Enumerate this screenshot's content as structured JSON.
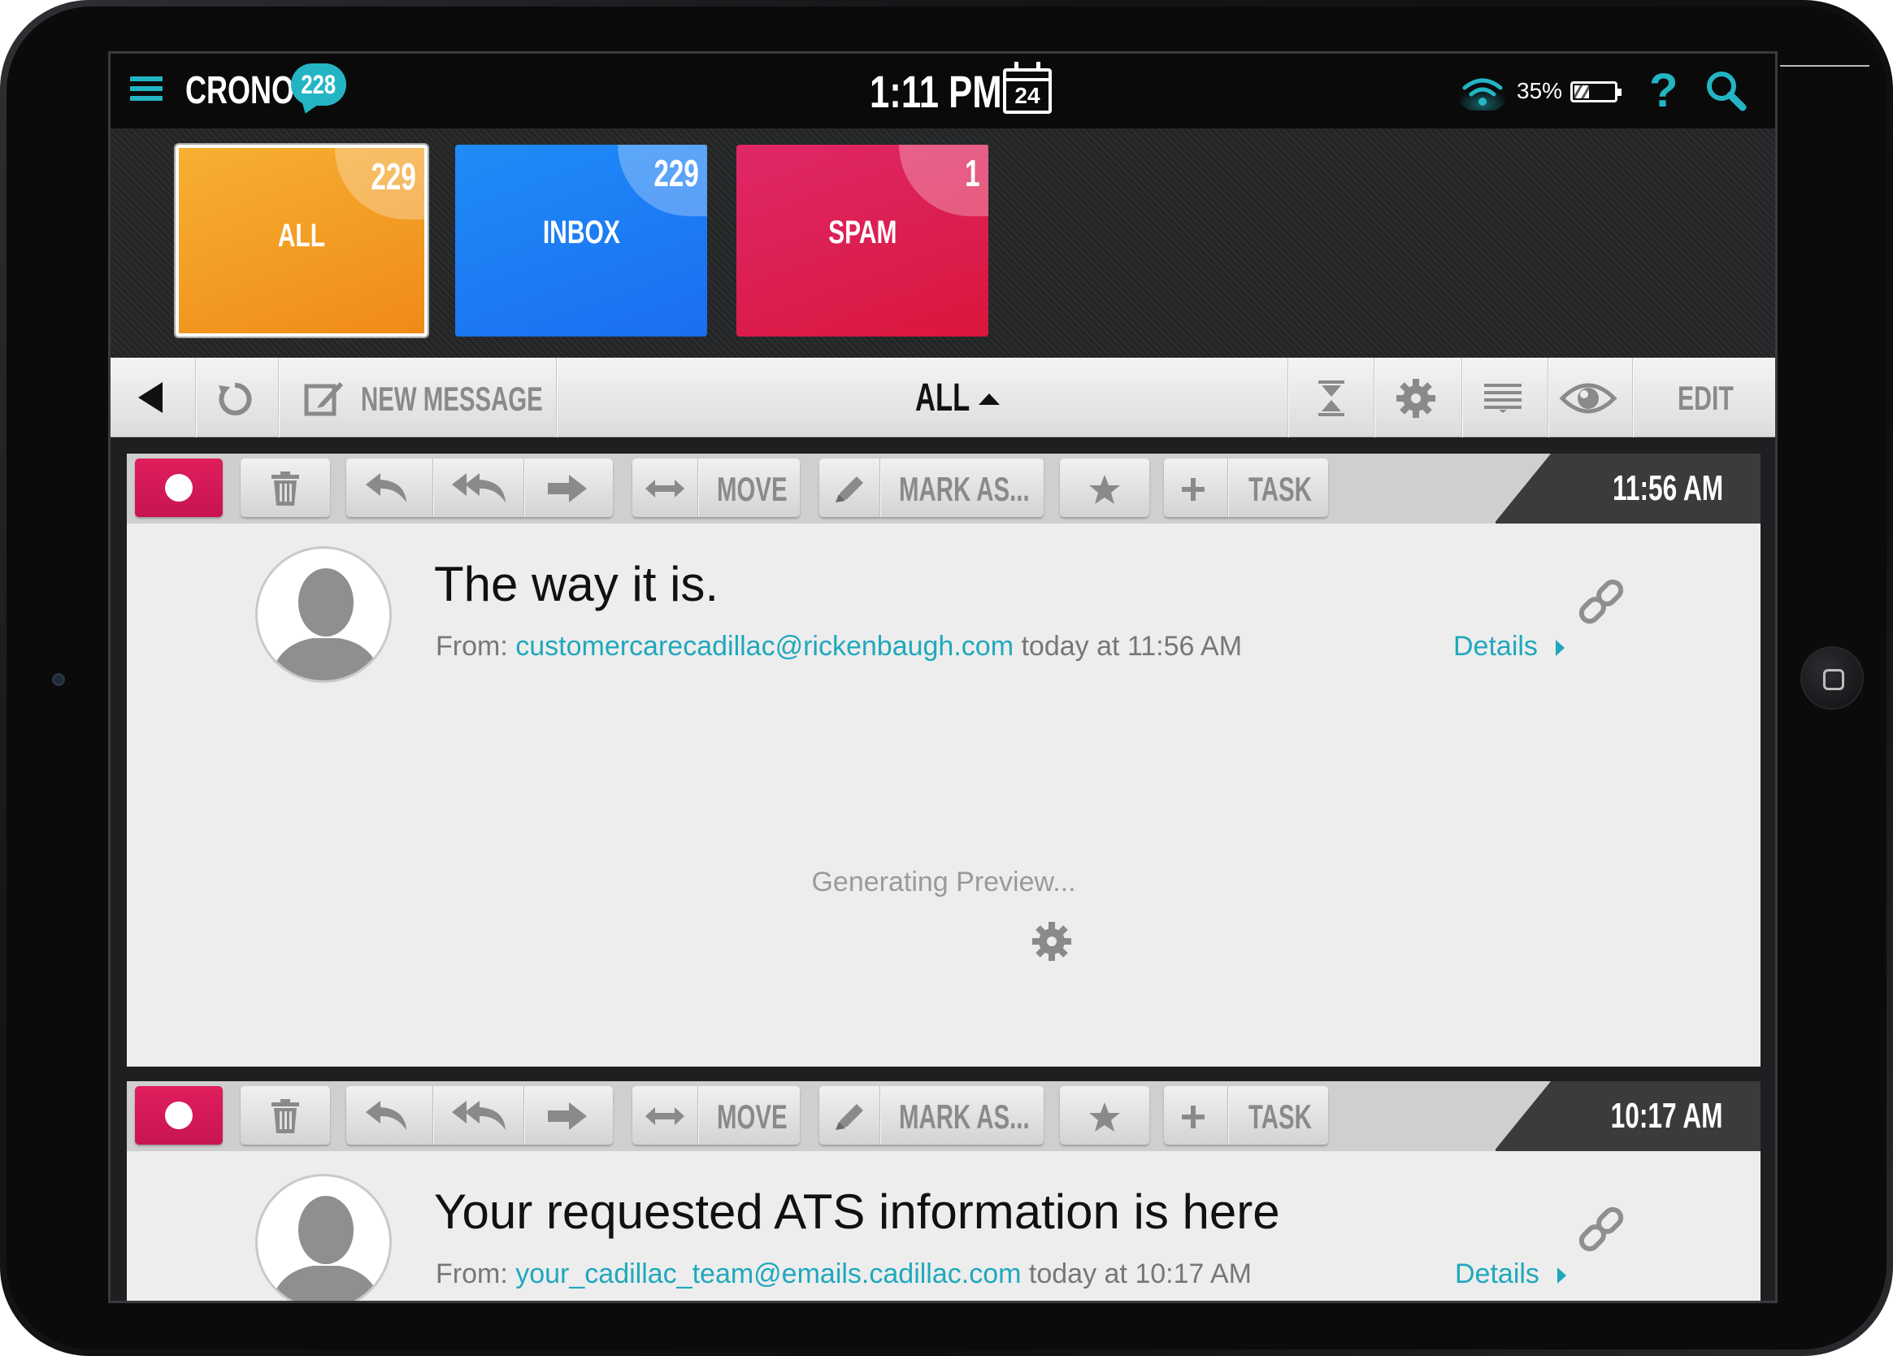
{
  "header": {
    "app_name": "CRONO",
    "unread_badge": "228",
    "clock": "1:11 PM",
    "calendar_day": "24",
    "battery_pct": "35%",
    "help_glyph": "?"
  },
  "tiles": [
    {
      "label": "ALL",
      "count": "229",
      "color": "#f29a1f"
    },
    {
      "label": "INBOX",
      "count": "229",
      "color": "#1d7ef4"
    },
    {
      "label": "SPAM",
      "count": "1",
      "color": "#dc1f4f"
    }
  ],
  "toolbar": {
    "new_message": "NEW MESSAGE",
    "folder": "ALL",
    "edit": "EDIT"
  },
  "actions": {
    "move": "MOVE",
    "mark_as": "MARK AS...",
    "task": "TASK"
  },
  "messages": [
    {
      "time": "11:56 AM",
      "subject": "The way it is.",
      "from_label": "From:",
      "from_addr": "customercarecadillac@rickenbaugh.com",
      "when": "today at 11:56 AM",
      "details": "Details",
      "preview_status": "Generating Preview..."
    },
    {
      "time": "10:17 AM",
      "subject": "Your requested ATS information is here",
      "from_label": "From:",
      "from_addr": "your_cadillac_team@emails.cadillac.com",
      "when": "today at 10:17 AM",
      "details": "Details"
    }
  ],
  "icons": [
    "menu-icon",
    "calendar-icon",
    "wifi-icon",
    "battery-icon",
    "help-icon",
    "search-icon",
    "back-icon",
    "refresh-icon",
    "compose-icon",
    "collapse-icon",
    "gear-icon",
    "list-icon",
    "eye-icon",
    "trash-icon",
    "reply-icon",
    "reply-all-icon",
    "forward-icon",
    "move-icon",
    "pencil-icon",
    "star-icon",
    "plus-icon",
    "link-icon",
    "avatar-icon"
  ],
  "accent": "#23b5c4"
}
